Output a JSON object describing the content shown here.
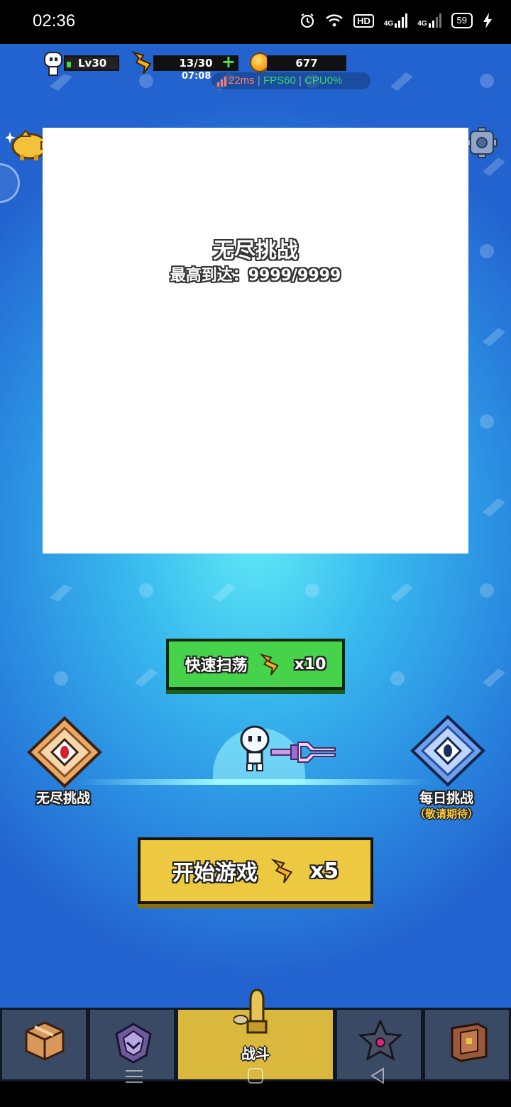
{
  "status_bar": {
    "time": "02:36",
    "network_4g_1": "4G",
    "network_4g_2": "4G",
    "hd_label": "HD",
    "battery": "59"
  },
  "hud": {
    "level": "Lv30",
    "energy": "13/30",
    "energy_plus": "+",
    "energy_timer": "07:08",
    "coins": "677",
    "latency": "22ms",
    "fps": "FPS60",
    "cpu": "CPU0%",
    "separator": "|"
  },
  "panel": {
    "title": "无尽挑战",
    "best_reached": "最高到达：9999/9999"
  },
  "sweep_button": {
    "label": "快速扫荡",
    "cost": "x10"
  },
  "modes": {
    "endless_label": "无尽挑战",
    "daily_label": "每日挑战",
    "daily_sub": "（敬请期待）"
  },
  "start_button": {
    "label": "开始游戏",
    "cost": "x5"
  },
  "tabs": {
    "battle_label": "战斗"
  },
  "colors": {
    "sweep_green": "#46d24a",
    "start_yellow": "#ecc940",
    "active_tab": "#d9b83d",
    "bg_blue": "#2a8ae0"
  }
}
